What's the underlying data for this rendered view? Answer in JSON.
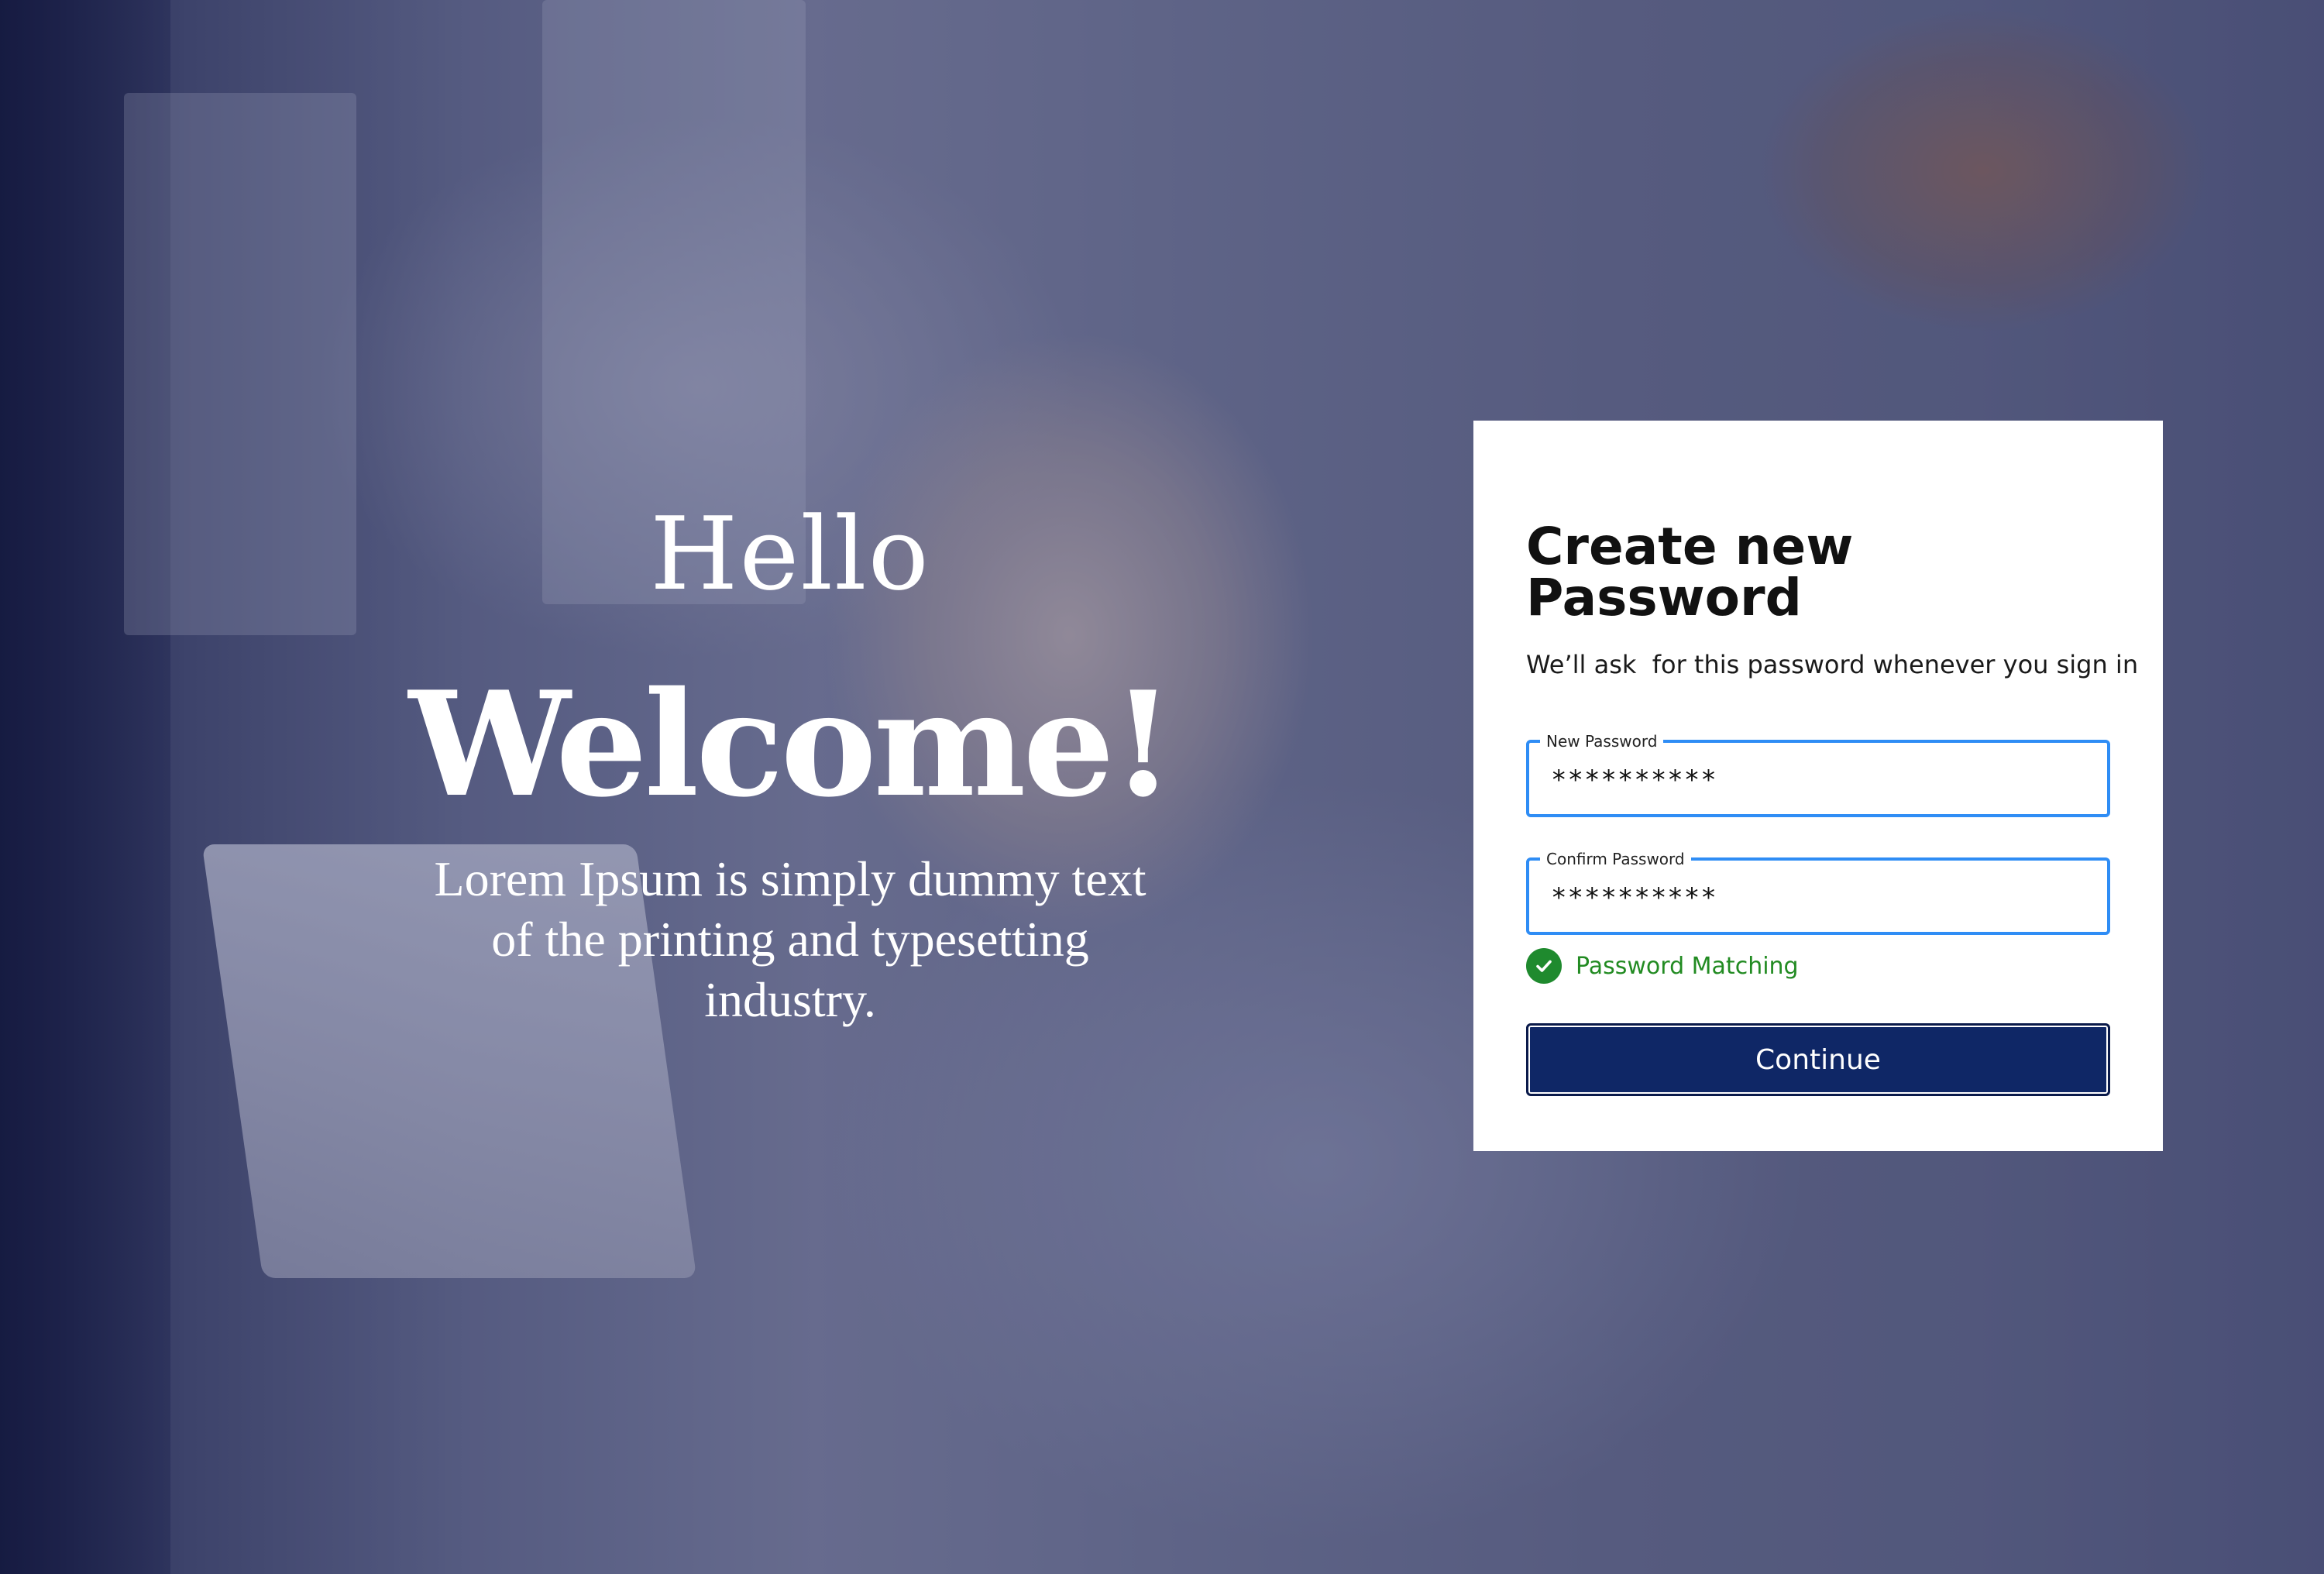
{
  "hero": {
    "greeting": "Hello",
    "headline": "Welcome!",
    "description": "Lorem Ipsum is simply dummy text of the printing and typesetting industry."
  },
  "form": {
    "title": "Create new Password",
    "subtitle": "We’ll ask  for this password whenever you sign in",
    "new_password": {
      "label": "New Password",
      "value": "**********"
    },
    "confirm_password": {
      "label": "Confirm Password",
      "value": "**********"
    },
    "status": {
      "text": "Password Matching",
      "color": "#228b22"
    },
    "continue_label": "Continue"
  },
  "colors": {
    "accent": "#2f8df5",
    "button": "#0f2766",
    "success": "#1f8a2e"
  },
  "icons": {
    "status": "check-circle-icon"
  }
}
